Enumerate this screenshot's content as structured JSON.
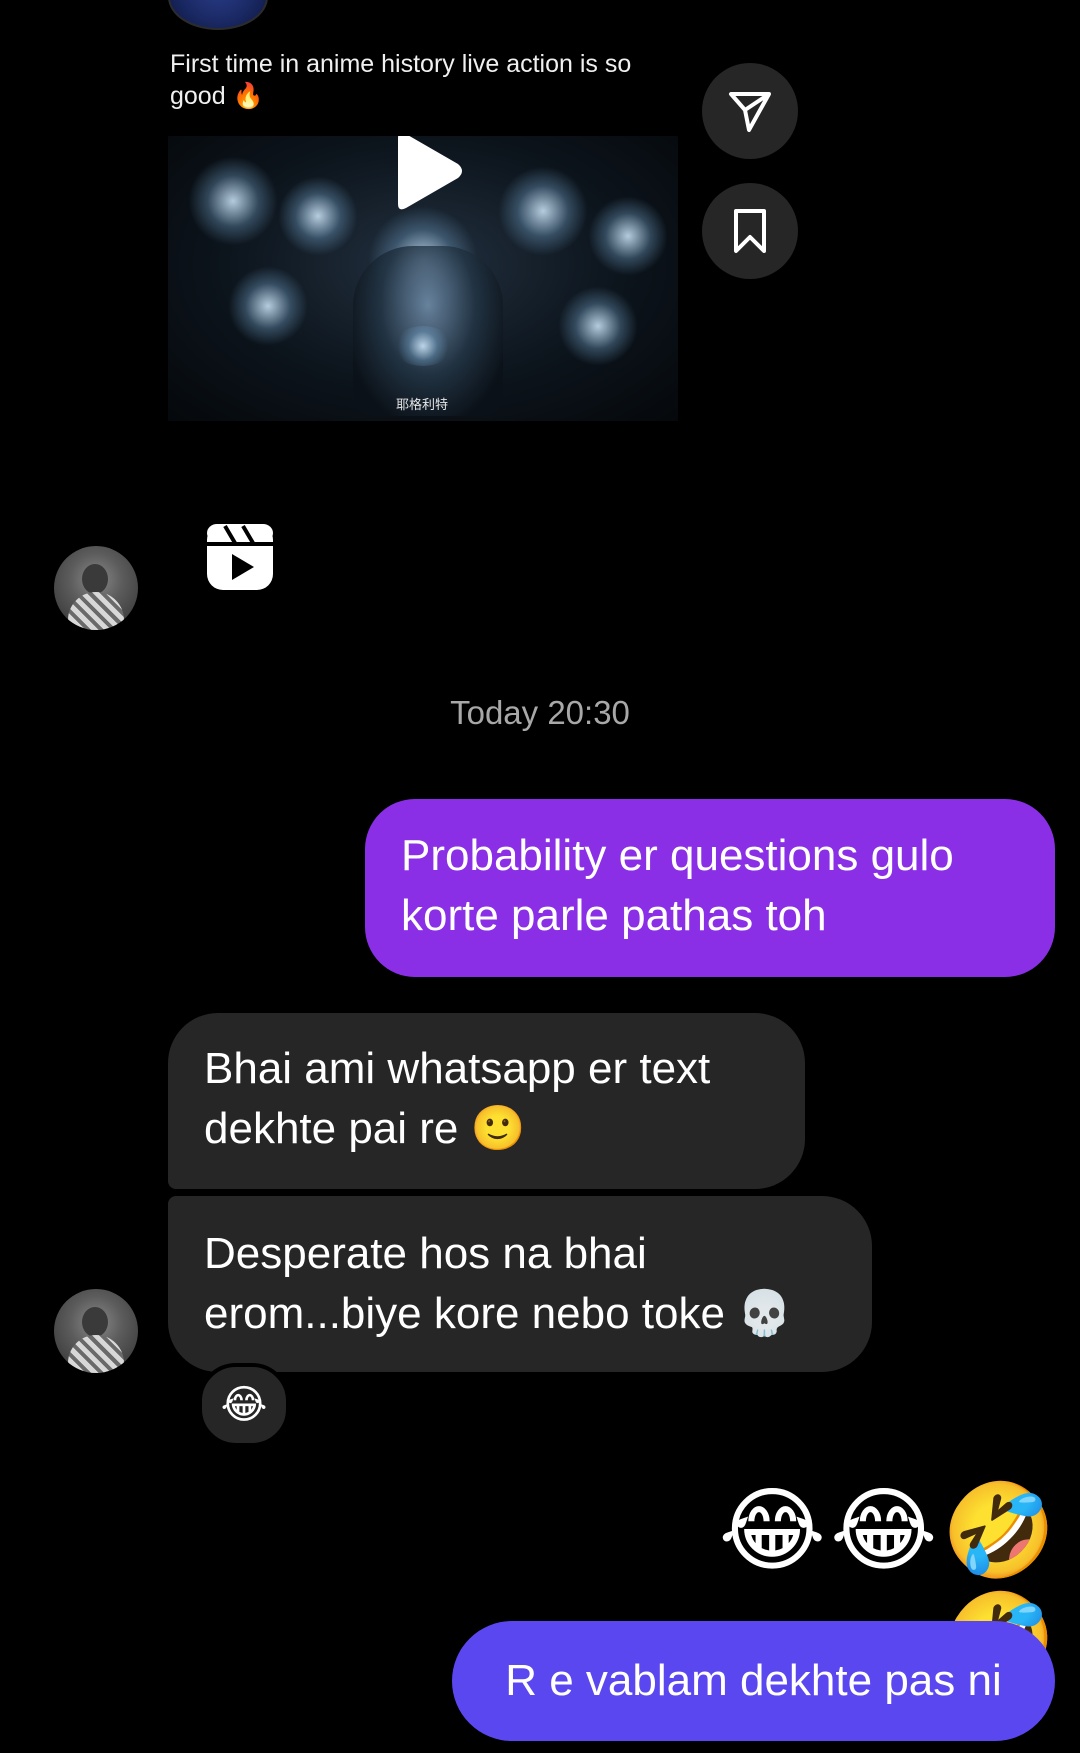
{
  "shared_post": {
    "caption": "First time in anime history live action is so good 🔥",
    "thumbnail_subtitle": "耶格利特",
    "icons": {
      "play": "play-icon",
      "share": "send-icon",
      "save": "bookmark-icon",
      "reels": "reels-icon"
    }
  },
  "timestamp": "Today 20:30",
  "messages": [
    {
      "from": "me",
      "text": "Probability er questions gulo korte parle pathas toh"
    },
    {
      "from": "them",
      "text": "Bhai ami whatsapp er text dekhte pai re 🙂"
    },
    {
      "from": "them",
      "text": "Desperate hos na bhai erom...biye kore nebo toke 💀",
      "reaction": "😂"
    },
    {
      "from": "me",
      "text": "😂😂🤣🤣"
    },
    {
      "from": "me",
      "text": "R e vablam dekhte pas ni"
    }
  ],
  "colors": {
    "background": "#000000",
    "sent_bubble_purple": "#8a2fe6",
    "sent_bubble_blue": "#5b47f0",
    "received_bubble": "#262626",
    "timestamp_text": "#a8a8a8"
  }
}
